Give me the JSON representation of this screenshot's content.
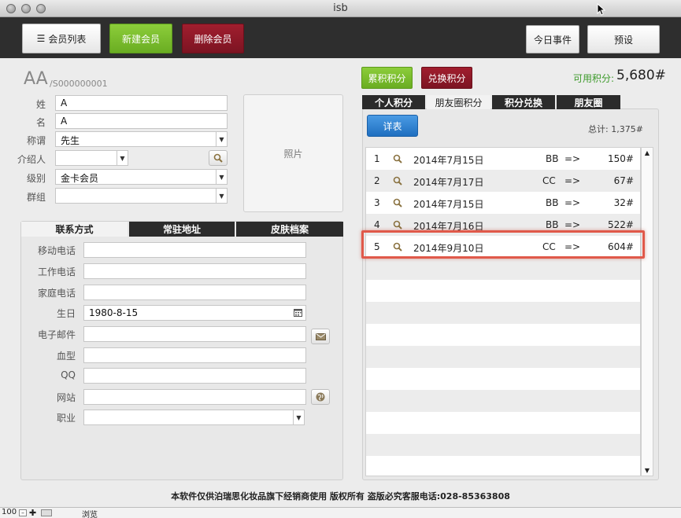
{
  "window": {
    "title": "isb"
  },
  "toolbar": {
    "member_list": "会员列表",
    "new_member": "新建会员",
    "delete_member": "删除会员",
    "today_events": "今日事件",
    "preset": "预设"
  },
  "member": {
    "name": "AA",
    "id": "/S000000001",
    "fields": {
      "surname_label": "姓",
      "surname": "A",
      "given_label": "名",
      "given": "A",
      "title_label": "称谓",
      "title": "先生",
      "referrer_label": "介绍人",
      "referrer": "",
      "level_label": "级别",
      "level": "金卡会员",
      "group_label": "群组",
      "group": ""
    },
    "photo_label": "照片"
  },
  "contact": {
    "tabs": [
      "联系方式",
      "常驻地址",
      "皮肤档案"
    ],
    "rows": [
      {
        "label": "移动电话",
        "value": ""
      },
      {
        "label": "工作电话",
        "value": ""
      },
      {
        "label": "家庭电话",
        "value": ""
      },
      {
        "label": "生日",
        "value": "1980-8-15"
      },
      {
        "label": "电子邮件",
        "value": ""
      },
      {
        "label": "血型",
        "value": ""
      },
      {
        "label": "QQ",
        "value": ""
      },
      {
        "label": "网站",
        "value": ""
      },
      {
        "label": "职业",
        "value": ""
      }
    ]
  },
  "points": {
    "earn_button": "累积积分",
    "redeem_button": "兑换积分",
    "available_label": "可用积分:",
    "available_value": "5,680#",
    "tabs": [
      "个人积分",
      "朋友圈积分",
      "积分兑换",
      "朋友圈"
    ],
    "detail_button": "详表",
    "total": "总计: 1,375#",
    "rows": [
      {
        "no": "1",
        "date": "2014年7月15日",
        "who": "BB",
        "arrow": "=>",
        "amount": "150#"
      },
      {
        "no": "2",
        "date": "2014年7月17日",
        "who": "CC",
        "arrow": "=>",
        "amount": "67#"
      },
      {
        "no": "3",
        "date": "2014年7月15日",
        "who": "BB",
        "arrow": "=>",
        "amount": "32#"
      },
      {
        "no": "4",
        "date": "2014年7月16日",
        "who": "BB",
        "arrow": "=>",
        "amount": "522#"
      },
      {
        "no": "5",
        "date": "2014年9月10日",
        "who": "CC",
        "arrow": "=>",
        "amount": "604#"
      }
    ]
  },
  "footer": {
    "text": "本软件仅供泊瑞思化妆品旗下经销商使用 版权所有 盗版必究客服电话:028-85363808"
  },
  "status": {
    "zoom": "100",
    "mode": "浏览"
  },
  "colors": {
    "accent_green": "#6aad22",
    "accent_red": "#7c1422",
    "accent_blue": "#1f6fc0",
    "highlight": "#e0594a"
  }
}
